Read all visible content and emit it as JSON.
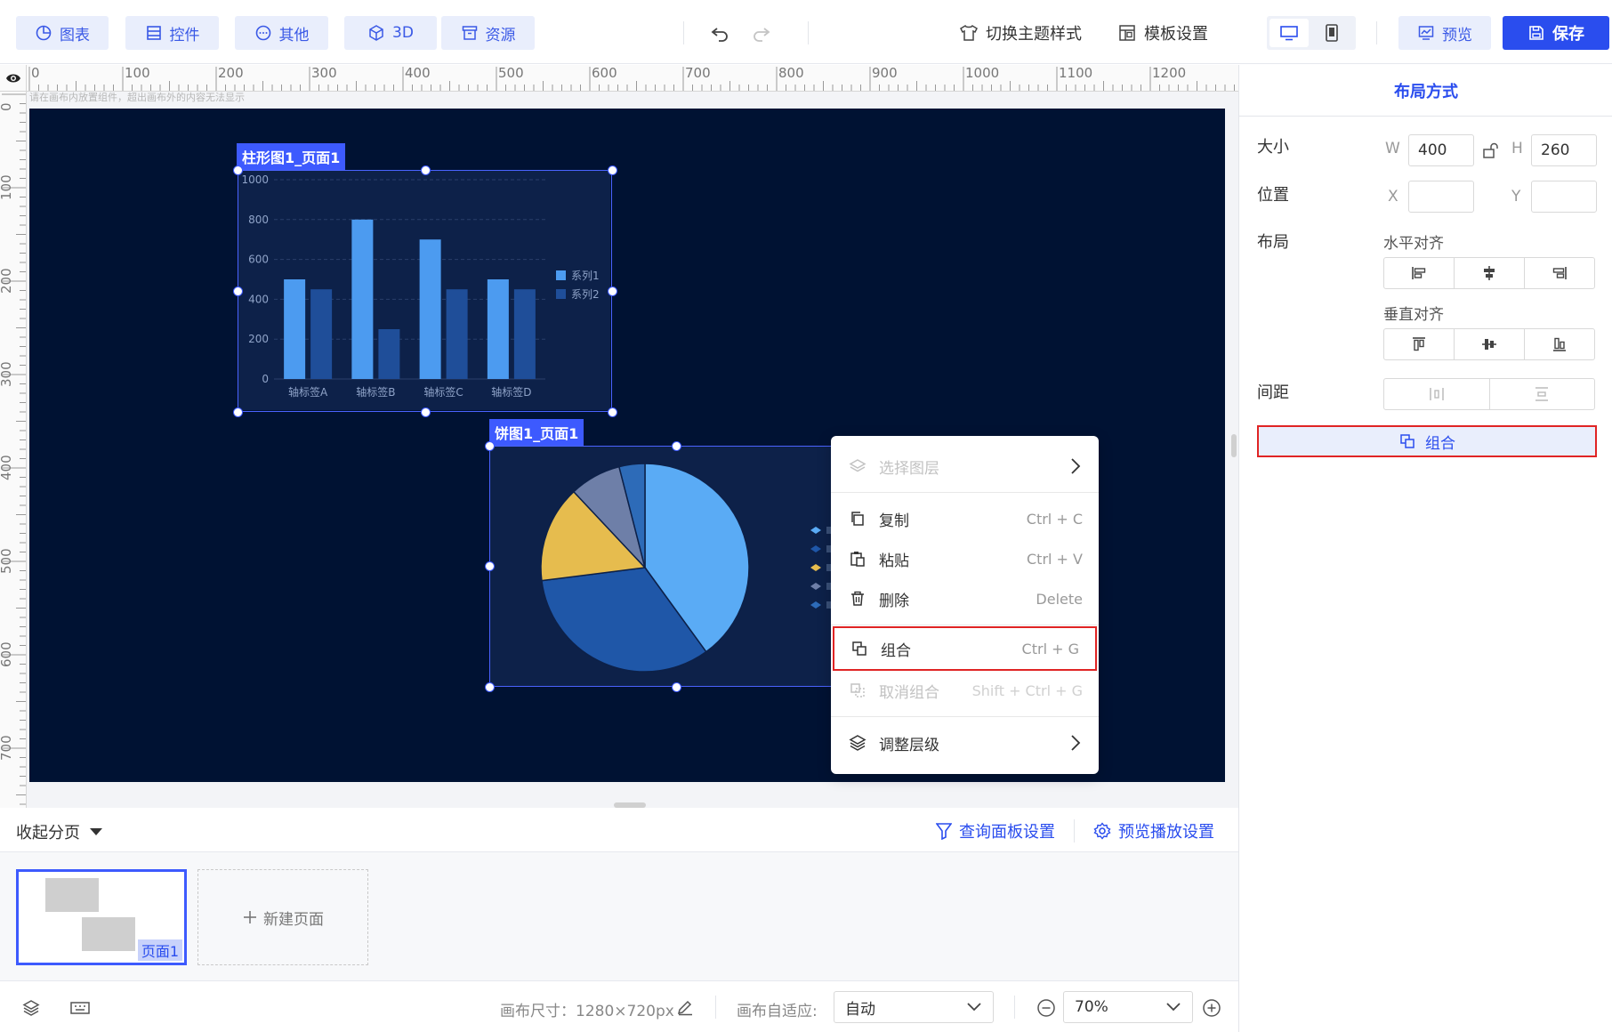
{
  "toolbar": {
    "chart_label": "图表",
    "controls_label": "控件",
    "other_label": "其他",
    "three_d_label": "3D",
    "resources_label": "资源",
    "theme_label": "切换主题样式",
    "template_label": "模板设置",
    "preview_label": "预览",
    "save_label": "保存"
  },
  "ruler": {
    "h_marks": [
      "0",
      "100",
      "200",
      "300",
      "400",
      "500",
      "600",
      "700",
      "800",
      "900",
      "1000",
      "1100",
      "1200"
    ],
    "v_marks": [
      "0",
      "100",
      "200",
      "300",
      "400",
      "500",
      "600",
      "700"
    ]
  },
  "canvas": {
    "hint": "请在画布内放置组件，超出画布外的内容无法显示"
  },
  "widgets": {
    "bar_title": "柱形图1_页面1",
    "pie_title": "饼图1_页面1"
  },
  "chart_data": [
    {
      "type": "bar",
      "categories": [
        "轴标签A",
        "轴标签B",
        "轴标签C",
        "轴标签D"
      ],
      "series": [
        {
          "name": "系列1",
          "values": [
            500,
            800,
            700,
            500
          ],
          "color": "#4c9bf0"
        },
        {
          "name": "系列2",
          "values": [
            450,
            250,
            450,
            450
          ],
          "color": "#1f4e99"
        }
      ],
      "ylim": [
        0,
        1000
      ],
      "yticks": [
        "0",
        "200",
        "400",
        "600",
        "800",
        "1000"
      ],
      "grid": true,
      "legend": "right"
    },
    {
      "type": "pie",
      "slices": [
        {
          "value": 40,
          "color": "#5aabf5"
        },
        {
          "value": 33,
          "color": "#1f57a8"
        },
        {
          "value": 15,
          "color": "#e6bc4e"
        },
        {
          "value": 8,
          "color": "#6e7fa8"
        },
        {
          "value": 4,
          "color": "#2d6bb8"
        }
      ],
      "legend": "right"
    }
  ],
  "context_menu": {
    "select_layer": "选择图层",
    "copy": "复制",
    "copy_shortcut": "Ctrl + C",
    "paste": "粘贴",
    "paste_shortcut": "Ctrl + V",
    "delete": "删除",
    "delete_shortcut": "Delete",
    "group": "组合",
    "group_shortcut": "Ctrl + G",
    "ungroup": "取消组合",
    "ungroup_shortcut": "Shift + Ctrl + G",
    "adjust_layer": "调整层级"
  },
  "right_panel": {
    "title": "布局方式",
    "size_label": "大小",
    "w_letter": "W",
    "w_value": "400",
    "h_letter": "H",
    "h_value": "260",
    "position_label": "位置",
    "x_letter": "X",
    "x_value": "",
    "y_letter": "Y",
    "y_value": "",
    "layout_label": "布局",
    "h_align_label": "水平对齐",
    "v_align_label": "垂直对齐",
    "spacing_label": "间距",
    "group_button": "组合"
  },
  "pages": {
    "collapse_label": "收起分页",
    "query_panel": "查询面板设置",
    "preview_play": "预览播放设置",
    "page1_label": "页面1",
    "new_page": "新建页面"
  },
  "status": {
    "canvas_size": "画布尺寸：1280×720px",
    "auto_fit_label": "画布自适应:",
    "auto_fit_value": "自动",
    "zoom_value": "70%"
  },
  "colors": {
    "accent": "#2a4dee",
    "canvas_bg": "#001233",
    "highlight": "#e02424"
  }
}
